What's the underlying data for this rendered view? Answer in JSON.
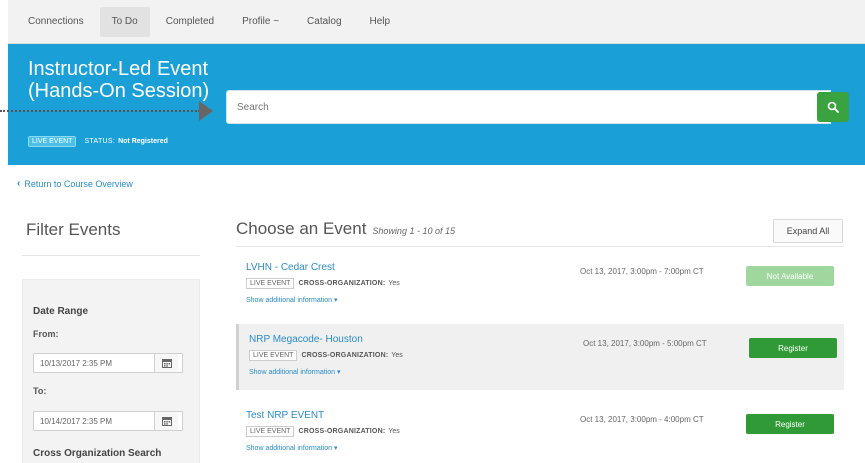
{
  "nav": {
    "items": [
      "Connections",
      "To Do",
      "Completed",
      "Profile ~",
      "Catalog",
      "Help"
    ],
    "active_index": 1
  },
  "hero": {
    "title": "Instructor-Led Event (Hands-On Session)",
    "badge": "LIVE EVENT",
    "status_label": "STATUS:",
    "status_value": "Not Registered"
  },
  "search": {
    "placeholder": "Search",
    "value": ""
  },
  "back_link": "Return to Course Overview",
  "sidebar": {
    "title": "Filter Events",
    "date_range_heading": "Date Range",
    "from_label": "From:",
    "from_value": "10/13/2017 2:35 PM",
    "to_label": "To:",
    "to_value": "10/14/2017 2:35 PM",
    "cross_org_heading": "Cross Organization Search"
  },
  "main": {
    "title": "Choose an Event",
    "showing": "Showing 1 - 10 of 15",
    "expand_all": "Expand All"
  },
  "events": [
    {
      "name": "LVHN - Cedar Crest",
      "badge": "LIVE EVENT",
      "cross_org_label": "CROSS-ORGANIZATION:",
      "cross_org_value": "Yes",
      "more": "Show additional information ▾",
      "date": "Oct 13, 2017, 3:00pm - 7:00pm CT",
      "button": "Not Available",
      "button_style": "faded"
    },
    {
      "name": "NRP Megacode- Houston",
      "badge": "LIVE EVENT",
      "cross_org_label": "CROSS-ORGANIZATION:",
      "cross_org_value": "Yes",
      "more": "Show additional information ▾",
      "date": "Oct 13, 2017, 3:00pm - 5:00pm CT",
      "button": "Register",
      "button_style": "green"
    },
    {
      "name": "Test NRP EVENT",
      "badge": "LIVE EVENT",
      "cross_org_label": "CROSS-ORGANIZATION:",
      "cross_org_value": "Yes",
      "more": "Show additional information ▾",
      "date": "Oct 13, 2017, 3:00pm - 4:00pm CT",
      "button": "Register",
      "button_style": "green"
    }
  ],
  "colors": {
    "header_blue": "#1a9fd6",
    "link_blue": "#2a8cc8",
    "register_green": "#2f9a36",
    "not_available_green": "#9fd79f"
  }
}
